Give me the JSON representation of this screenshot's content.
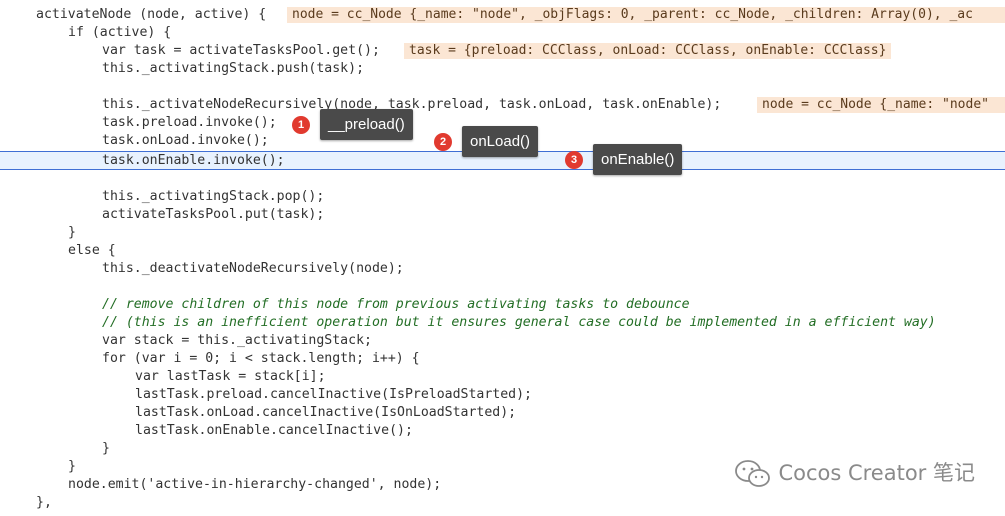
{
  "code_lines": [
    "activateNode (node, active) {",
    "if (active) {",
    "var task = activateTasksPool.get();",
    "this._activatingStack.push(task);",
    "",
    "this._activateNodeRecursively(node, task.preload, task.onLoad, task.onEnable);",
    "task.preload.invoke();",
    "task.onLoad.invoke();",
    "task.onEnable.invoke();",
    "",
    "this._activatingStack.pop();",
    "activateTasksPool.put(task);",
    "}",
    "else {",
    "this._deactivateNodeRecursively(node);",
    "",
    "// remove children of this node from previous activating tasks to debounce",
    "// (this is an inefficient operation but it ensures general case could be implemented in a efficient way)",
    "var stack = this._activatingStack;",
    "for (var i = 0; i < stack.length; i++) {",
    "var lastTask = stack[i];",
    "lastTask.preload.cancelInactive(IsPreloadStarted);",
    "lastTask.onLoad.cancelInactive(IsOnLoadStarted);",
    "lastTask.onEnable.cancelInactive();",
    "}",
    "}",
    "node.emit('active-in-hierarchy-changed', node);",
    "},"
  ],
  "inline_values": {
    "line1": "node = cc_Node {_name: \"node\", _objFlags: 0, _parent: cc_Node, _children: Array(0), _ac",
    "line3": "task = {preload: CCClass, onLoad: CCClass, onEnable: CCClass}",
    "line6": "node = cc_Node {_name: \"node\""
  },
  "annotations": [
    {
      "number": "1",
      "label": "__preload()"
    },
    {
      "number": "2",
      "label": "onLoad()"
    },
    {
      "number": "3",
      "label": "onEnable()"
    }
  ],
  "watermark": "Cocos Creator 笔记",
  "colors": {
    "keyword": "#aa0d91",
    "comment": "#236e25",
    "string": "#c41a16",
    "inline_value_bg": "#fbe6d4",
    "current_line_bg": "#e8f2fe",
    "current_line_border": "#3f6fd4",
    "badge": "#e13a2f",
    "tooltip_bg": "#4a4a4a"
  }
}
